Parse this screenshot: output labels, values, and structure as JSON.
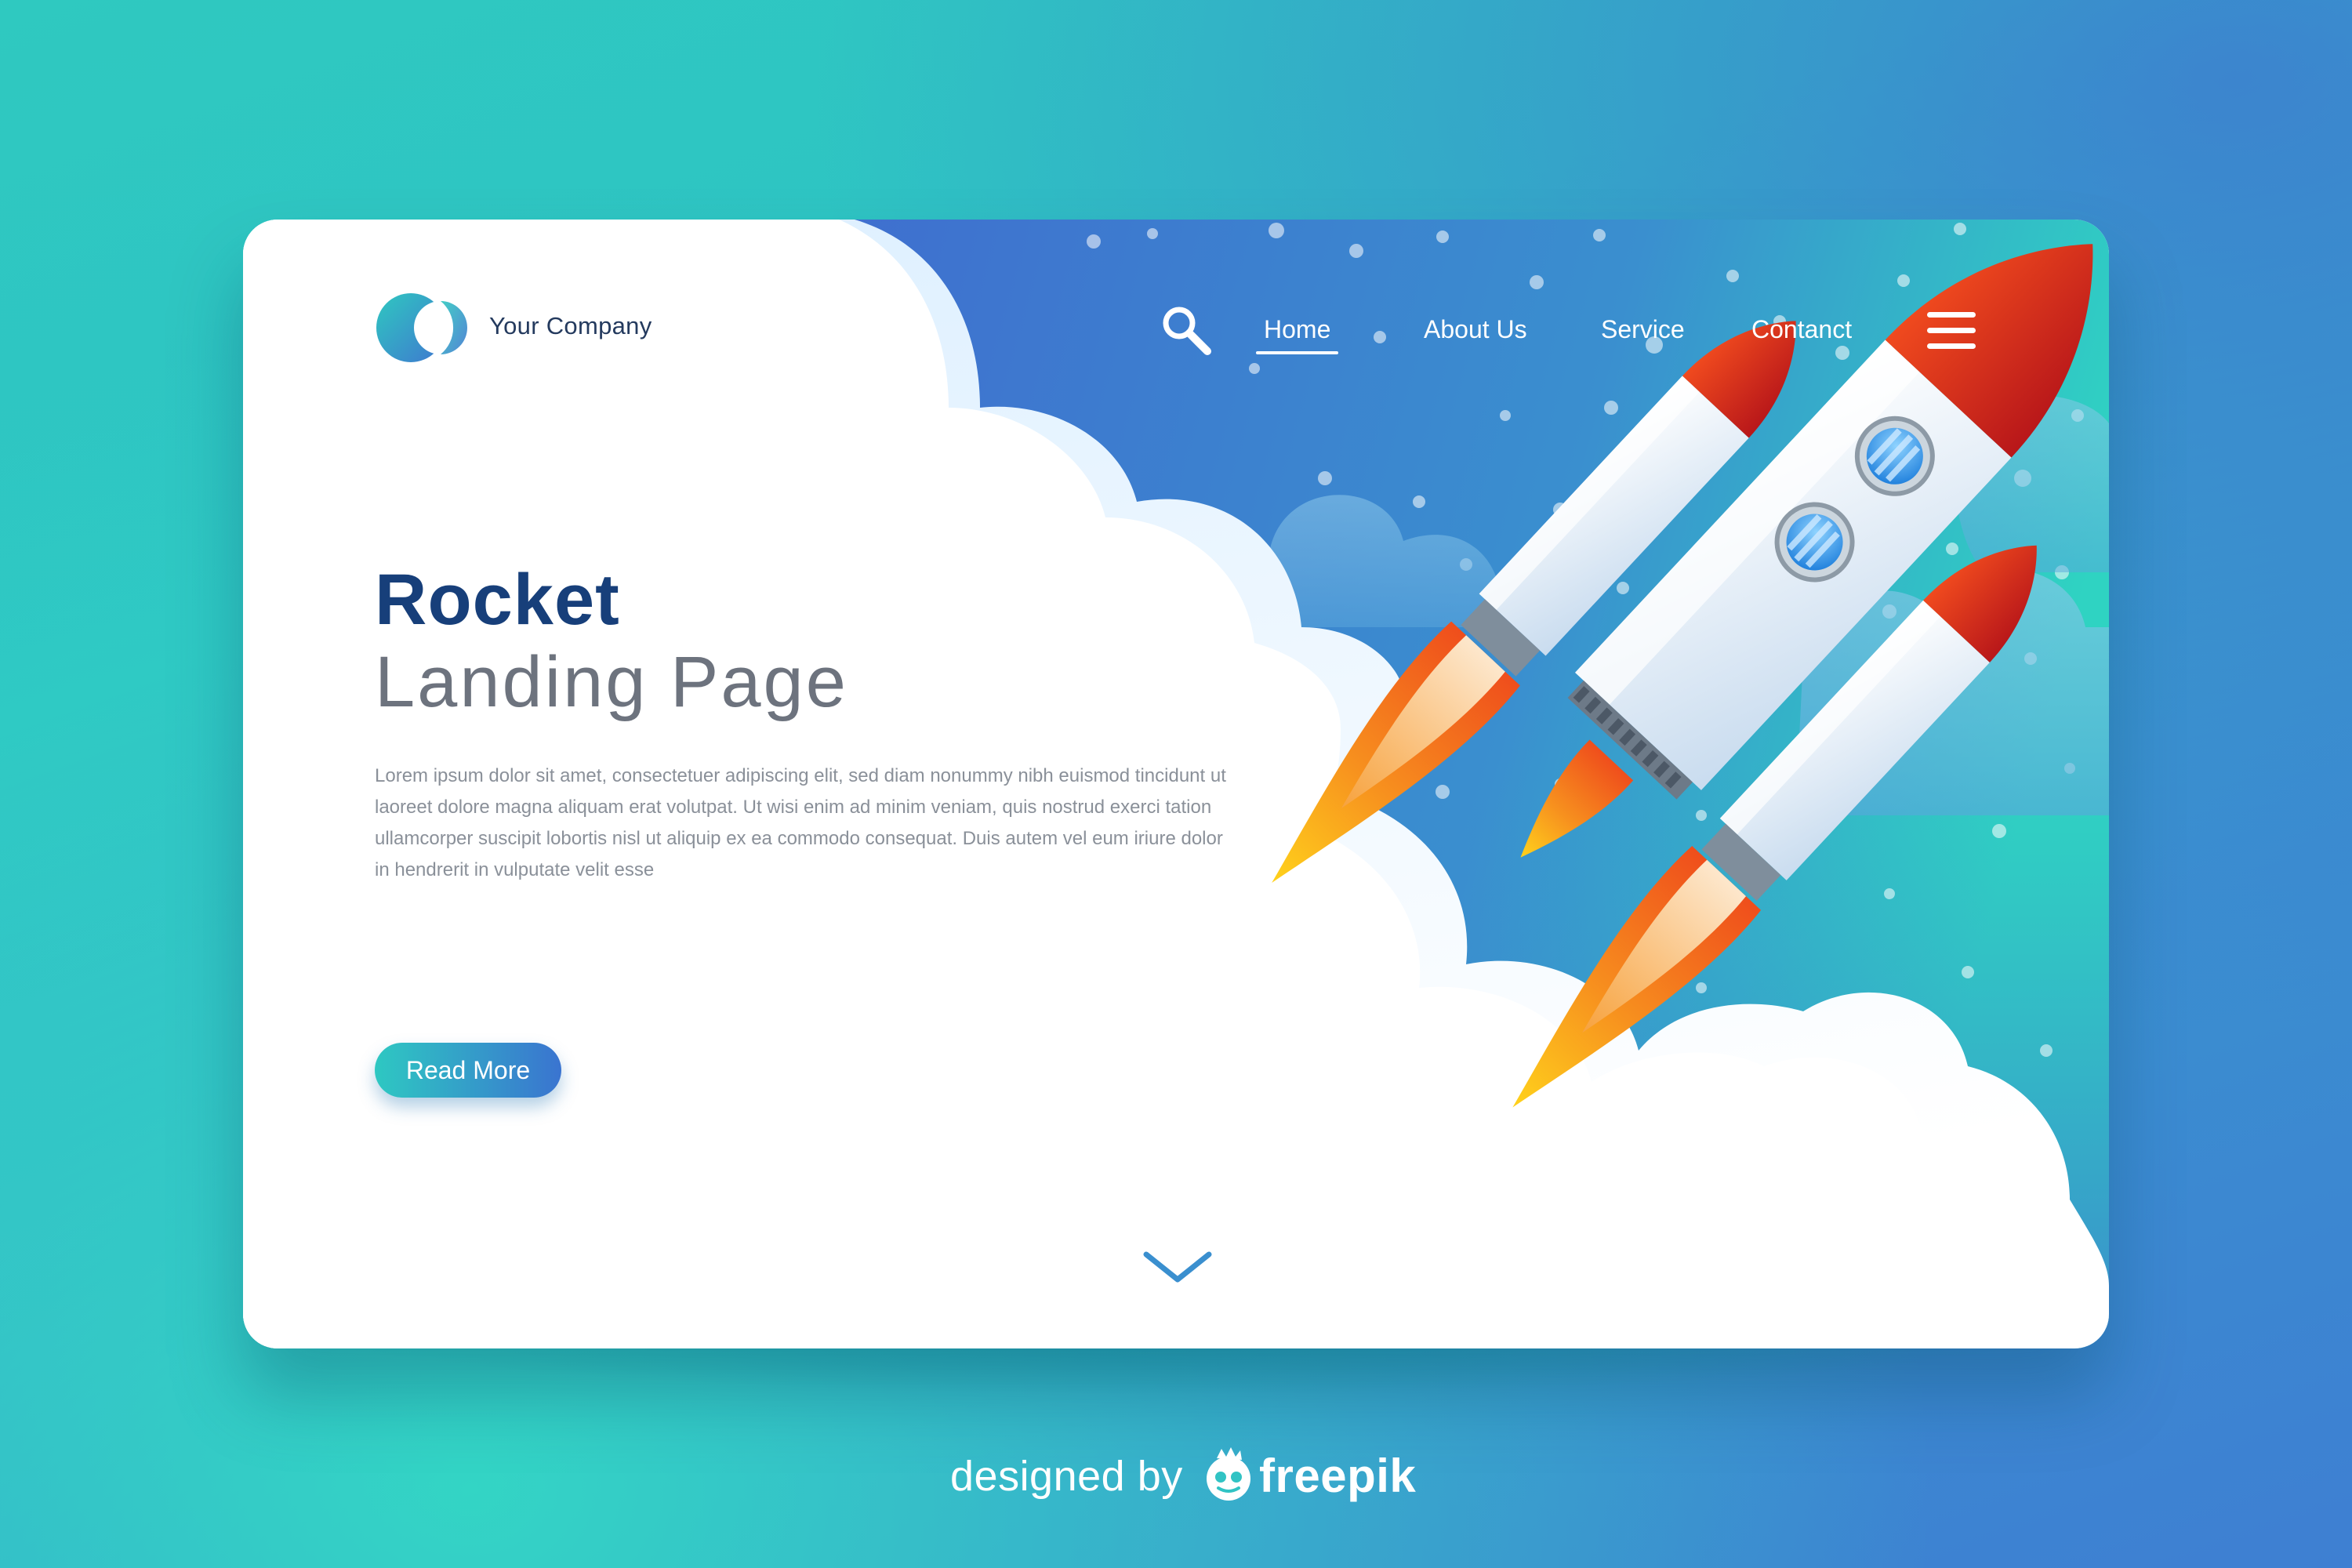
{
  "brand": {
    "name": "Your Company",
    "logo_icon": "overlapping-circles-logo"
  },
  "header": {
    "search_icon": "search-icon",
    "nav": [
      {
        "label": "Home",
        "active": true
      },
      {
        "label": "About Us",
        "active": false
      },
      {
        "label": "Service",
        "active": false
      },
      {
        "label": "Contanct",
        "active": false
      }
    ],
    "menu_icon": "hamburger-menu-icon"
  },
  "hero": {
    "title": "Rocket",
    "subtitle": "Landing Page",
    "description": "Lorem ipsum dolor sit amet, consectetuer adipiscing elit, sed diam nonummy nibh euismod tincidunt ut laoreet dolore magna aliquam erat volutpat. Ut wisi enim ad minim veniam, quis nostrud exerci tation ullamcorper suscipit lobortis nisl ut aliquip ex ea commodo consequat. Duis autem vel eum iriure dolor in hendrerit in vulputate velit esse",
    "cta_label": "Read More",
    "scroll_icon": "chevron-down-icon",
    "illustration": "rocket-launch-illustration"
  },
  "footer": {
    "credit_text": "designed by",
    "credit_brand": "freepik"
  },
  "colors": {
    "title": "#173f7a",
    "subtitle": "#6d737e",
    "teal": "#2ec8c2",
    "blue": "#3a74d0",
    "rocket_red": "#e8411e",
    "flame_orange": "#f4811f",
    "flame_yellow": "#ffcc1c"
  }
}
